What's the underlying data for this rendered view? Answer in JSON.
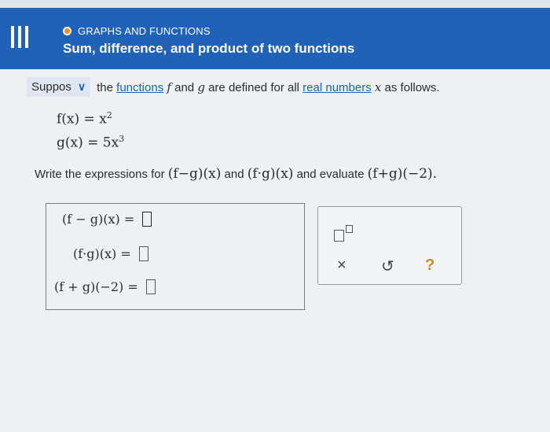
{
  "header": {
    "topic": "GRAPHS AND FUNCTIONS",
    "title": "Sum, difference, and product of two functions"
  },
  "question": {
    "suppose_label": "Suppos",
    "intro_pre": "the",
    "link_functions": "functions",
    "f": "f",
    "and": "and",
    "g": "g",
    "mid": "are defined for all",
    "link_real_numbers": "real numbers",
    "x": "x",
    "tail": "as follows."
  },
  "functions": {
    "f_lhs": "f(x) = x",
    "f_exp": "2",
    "g_lhs": "g(x) = 5x",
    "g_exp": "3"
  },
  "instruction": {
    "pre": "Write the expressions for",
    "expr1": "(f−g)(x)",
    "and": "and",
    "expr2": "(f·g)(x)",
    "mid": "and evaluate",
    "expr3": "(f+g)(−2)."
  },
  "answers": [
    {
      "label": "(f − g)(x) ="
    },
    {
      "label": "(f·g)(x) ="
    },
    {
      "label": "(f + g)(−2) ="
    }
  ],
  "tools": {
    "clear": "×",
    "undo": "↺",
    "help": "?"
  },
  "colors": {
    "header_blue": "#1f62b8",
    "topic_dot": "#f08a1c",
    "link": "#1f62b8",
    "help": "#d08a1a"
  }
}
